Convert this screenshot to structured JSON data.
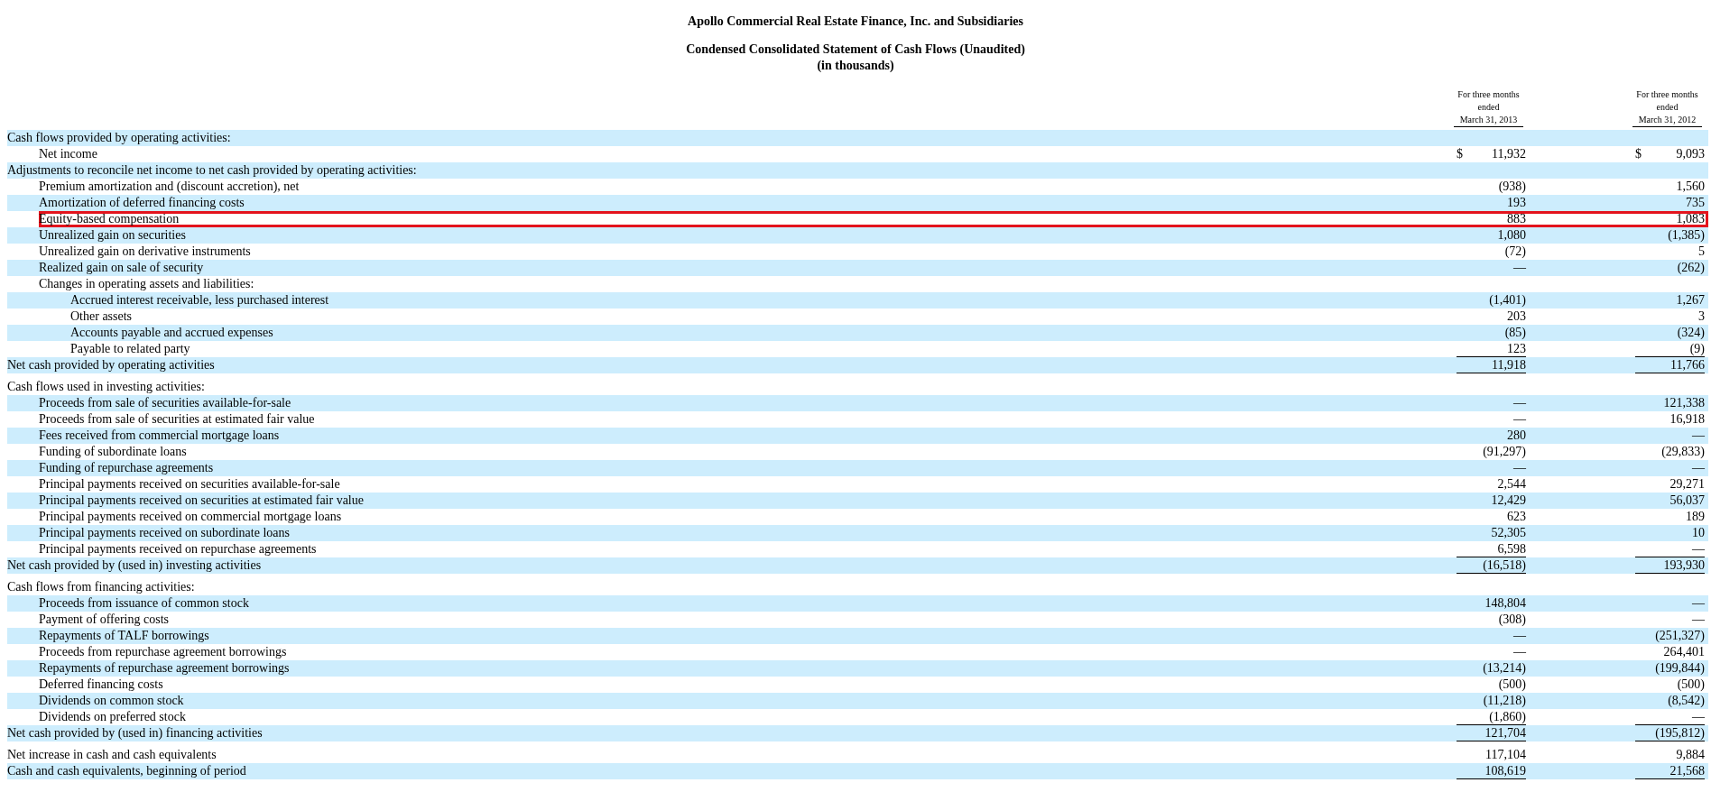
{
  "titles": [
    "Apollo Commercial Real Estate Finance, Inc. and Subsidiaries",
    "Condensed Consolidated Statement of Cash Flows (Unaudited)",
    "(in thousands)"
  ],
  "columns": [
    {
      "lines": [
        "For three months",
        "ended",
        "March 31, 2013"
      ]
    },
    {
      "lines": [
        "For three months",
        "ended",
        "March 31, 2012"
      ]
    }
  ],
  "sections": [
    {
      "rows": [
        {
          "label": "Cash flows provided by operating activities:",
          "highlighted": false,
          "children": [
            {
              "label": "Net income",
              "currency": "$",
              "values": [
                "11,932",
                "9,093"
              ],
              "highlighted": false,
              "underlined": false
            }
          ]
        },
        {
          "label": "Adjustments to reconcile net income to net cash provided by operating activities:",
          "highlighted": false,
          "children": [
            {
              "label": "Premium amortization and (discount accretion), net",
              "values": [
                "(938)",
                "1,560"
              ],
              "highlighted": false,
              "underlined": false
            },
            {
              "label": "Amortization of deferred financing costs",
              "values": [
                "193",
                "735"
              ],
              "highlighted": false,
              "underlined": false
            },
            {
              "label": "Equity-based compensation",
              "values": [
                "883",
                "1,083"
              ],
              "highlighted": true,
              "underlined": false
            },
            {
              "label": "Unrealized gain on securities",
              "values": [
                "1,080",
                "(1,385)"
              ],
              "highlighted": false,
              "underlined": false
            },
            {
              "label": "Unrealized gain on derivative instruments",
              "values": [
                "(72)",
                "5"
              ],
              "highlighted": false,
              "underlined": false
            },
            {
              "label": "Realized gain on sale of security",
              "values": [
                "—",
                "(262)"
              ],
              "highlighted": false,
              "underlined": false
            },
            {
              "label": "Changes in operating assets and liabilities:",
              "highlighted": false,
              "children": [
                {
                  "label": "Accrued interest receivable, less purchased interest",
                  "values": [
                    "(1,401)",
                    "1,267"
                  ],
                  "highlighted": false,
                  "underlined": false
                },
                {
                  "label": "Other assets",
                  "values": [
                    "203",
                    "3"
                  ],
                  "highlighted": false,
                  "underlined": false
                },
                {
                  "label": "Accounts payable and accrued expenses",
                  "values": [
                    "(85)",
                    "(324)"
                  ],
                  "highlighted": false,
                  "underlined": false
                },
                {
                  "label": "Payable to related party",
                  "values": [
                    "123",
                    "(9)"
                  ],
                  "highlighted": false,
                  "underlined": true
                }
              ]
            }
          ]
        },
        {
          "label": "Net cash provided by operating activities",
          "values": [
            "11,918",
            "11,766"
          ],
          "highlighted": false,
          "underlined": true
        }
      ]
    },
    {
      "rows": [
        {
          "label": "Cash flows used in investing activities:",
          "highlighted": false,
          "children": [
            {
              "label": "Proceeds from sale of securities available-for-sale",
              "values": [
                "—",
                "121,338"
              ],
              "highlighted": false,
              "underlined": false
            },
            {
              "label": "Proceeds from sale of securities at estimated fair value",
              "values": [
                "—",
                "16,918"
              ],
              "highlighted": false,
              "underlined": false
            },
            {
              "label": "Fees received from commercial mortgage loans",
              "values": [
                "280",
                "—"
              ],
              "highlighted": false,
              "underlined": false
            },
            {
              "label": "Funding of subordinate loans",
              "values": [
                "(91,297)",
                "(29,833)"
              ],
              "highlighted": false,
              "underlined": false
            },
            {
              "label": "Funding of repurchase agreements",
              "values": [
                "—",
                "—"
              ],
              "highlighted": false,
              "underlined": false
            },
            {
              "label": "Principal payments received on securities available-for-sale",
              "values": [
                "2,544",
                "29,271"
              ],
              "highlighted": false,
              "underlined": false
            },
            {
              "label": "Principal payments received on securities at estimated fair value",
              "values": [
                "12,429",
                "56,037"
              ],
              "highlighted": false,
              "underlined": false
            },
            {
              "label": "Principal payments received on commercial mortgage loans",
              "values": [
                "623",
                "189"
              ],
              "highlighted": false,
              "underlined": false
            },
            {
              "label": "Principal payments received on subordinate loans",
              "values": [
                "52,305",
                "10"
              ],
              "highlighted": false,
              "underlined": false
            },
            {
              "label": "Principal payments received on repurchase agreements",
              "values": [
                "6,598",
                "—"
              ],
              "highlighted": false,
              "underlined": true
            }
          ]
        },
        {
          "label": "Net cash provided by (used in) investing activities",
          "values": [
            "(16,518)",
            "193,930"
          ],
          "highlighted": false,
          "underlined": true
        }
      ]
    },
    {
      "rows": [
        {
          "label": "Cash flows from financing activities:",
          "highlighted": false,
          "children": [
            {
              "label": "Proceeds from issuance of common stock",
              "values": [
                "148,804",
                "—"
              ],
              "highlighted": false,
              "underlined": false
            },
            {
              "label": "Payment of offering costs",
              "values": [
                "(308)",
                "—"
              ],
              "highlighted": false,
              "underlined": false
            },
            {
              "label": "Repayments of TALF borrowings",
              "values": [
                "—",
                "(251,327)"
              ],
              "highlighted": false,
              "underlined": false
            },
            {
              "label": "Proceeds from repurchase agreement borrowings",
              "values": [
                "—",
                "264,401"
              ],
              "highlighted": false,
              "underlined": false
            },
            {
              "label": "Repayments of repurchase agreement borrowings",
              "values": [
                "(13,214)",
                "(199,844)"
              ],
              "highlighted": false,
              "underlined": false
            },
            {
              "label": "Deferred financing costs",
              "values": [
                "(500)",
                "(500)"
              ],
              "highlighted": false,
              "underlined": false
            },
            {
              "label": "Dividends on common stock",
              "values": [
                "(11,218)",
                "(8,542)"
              ],
              "highlighted": false,
              "underlined": false
            },
            {
              "label": "Dividends on preferred stock",
              "values": [
                "(1,860)",
                "—"
              ],
              "highlighted": false,
              "underlined": true
            }
          ]
        },
        {
          "label": "Net cash provided by (used in) financing activities",
          "values": [
            "121,704",
            "(195,812)"
          ],
          "highlighted": false,
          "underlined": true
        }
      ]
    },
    {
      "rows": [
        {
          "label": "Net increase in cash and cash equivalents",
          "values": [
            "117,104",
            "9,884"
          ],
          "highlighted": false,
          "underlined": false
        },
        {
          "label": "Cash and cash equivalents, beginning of period",
          "values": [
            "108,619",
            "21,568"
          ],
          "highlighted": false,
          "underlined": true
        }
      ]
    }
  ]
}
